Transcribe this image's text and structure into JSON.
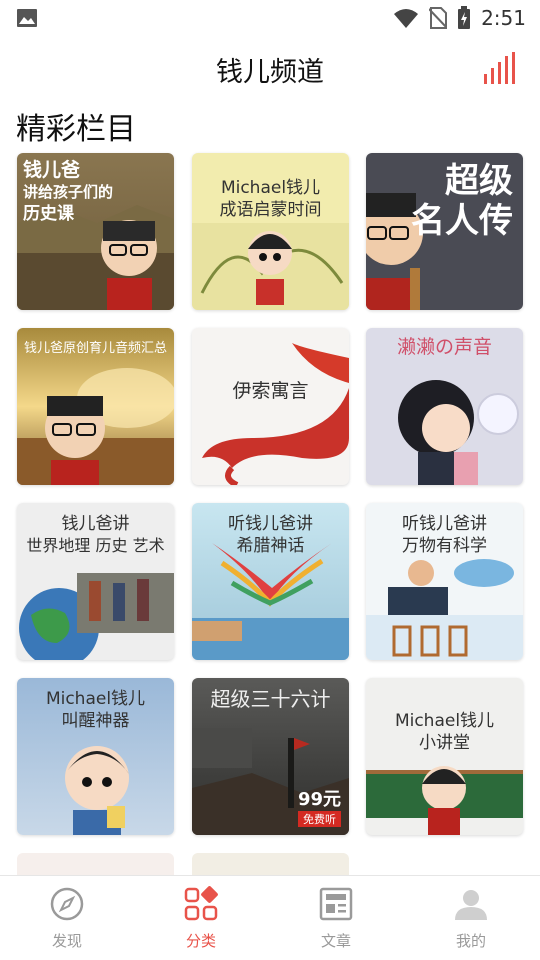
{
  "status": {
    "time": "2:51"
  },
  "header": {
    "title": "钱儿频道"
  },
  "section": {
    "title": "精彩栏目"
  },
  "cards": [
    {
      "lines": [
        "钱儿爸",
        "讲给孩子们的",
        "历史课"
      ]
    },
    {
      "lines": [
        "Michael钱儿",
        "成语启蒙时间"
      ]
    },
    {
      "lines": [
        "超级",
        "名人传"
      ]
    },
    {
      "lines": [
        "钱儿爸原创育儿音频汇总"
      ]
    },
    {
      "lines": [
        "伊索寓言"
      ]
    },
    {
      "lines": [
        "濑濑の声音"
      ]
    },
    {
      "lines": [
        "钱儿爸讲",
        "世界地理 历史 艺术"
      ]
    },
    {
      "lines": [
        "听钱儿爸讲",
        "希腊神话"
      ]
    },
    {
      "lines": [
        "听钱儿爸讲",
        "万物有科学"
      ]
    },
    {
      "lines": [
        "Michael钱儿",
        "叫醒神器"
      ]
    },
    {
      "lines": [
        "超级三十六计"
      ],
      "badge": "99元",
      "badge_sub": "免费听"
    },
    {
      "lines": [
        "Michael钱儿",
        "小讲堂"
      ]
    }
  ],
  "nav": [
    {
      "label": "发现",
      "icon": "compass-icon",
      "active": false
    },
    {
      "label": "分类",
      "icon": "category-icon",
      "active": true
    },
    {
      "label": "文章",
      "icon": "article-icon",
      "active": false
    },
    {
      "label": "我的",
      "icon": "profile-icon",
      "active": false
    }
  ],
  "colors": {
    "accent": "#e8534a",
    "inactive": "#9a9a9a"
  }
}
